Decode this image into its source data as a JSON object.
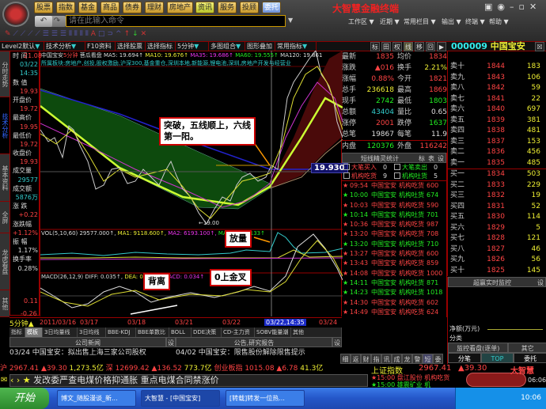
{
  "app": {
    "title": "大智慧金融终端",
    "menu": [
      "股票",
      "指数",
      "基金",
      "商品",
      "债券",
      "理财",
      "房地产",
      "资讯",
      "服务",
      "投顾",
      "委托"
    ],
    "command_placeholder": "请在此输入命令",
    "right_menu": [
      "工作区 ▼",
      "近期 ▼",
      "常用栏目 ▼",
      "输出 ▼",
      "终端 ▼",
      "帮助 ▼"
    ]
  },
  "toolbar": {
    "items": [
      "Level2默认",
      "技术分析",
      "F10资料",
      "选择股票",
      "选择指标",
      "5分钟",
      "多图组合",
      "图形叠加",
      "常用指标"
    ],
    "view_buttons": [
      "标",
      "田",
      "权",
      "线",
      "移",
      "回",
      "▶"
    ],
    "stock_code": "000009",
    "stock_name": "中国宝安",
    "close": "☒"
  },
  "side_tabs": [
    "分时走势",
    "技术分析",
    "基本资料",
    "全屏",
    "龙虎看盘",
    "其他"
  ],
  "info_panel": [
    [
      "时  间",
      "03/22",
      "14:35"
    ],
    [
      "数  值",
      "19.93"
    ],
    [
      "开盘价",
      "19.72"
    ],
    [
      "最高价",
      "19.95"
    ],
    [
      "最低价",
      "19.72"
    ],
    [
      "收盘价",
      "19.93"
    ],
    [
      "成交量",
      "29577"
    ],
    [
      "成交额",
      "5876万"
    ],
    [
      "涨  跌",
      "+0.22"
    ],
    [
      "涨跌幅",
      "+1.12%"
    ],
    [
      "振  幅",
      "1.17%"
    ],
    [
      "换手率",
      "0.28%"
    ]
  ],
  "chart": {
    "header": "中国宝安",
    "period": "5分钟",
    "mode": "菩瓜看盘",
    "ma5": "MA5: 19.694↑",
    "ma10": "MA10: 19.676↑",
    "ma35": "MA35: 19.686↑",
    "ma60": "MA60: 19.555↑",
    "ma120": "MA120: 19.861",
    "sectors": "所属板块:房地产,创投,股权激励,沪深300,基金重仓,深圳本地,新能源,锂电池,深圳,房地产开发与经营业",
    "price_top": "21.08",
    "low_mark": "←19.00",
    "price_tag": "19.930",
    "vol_header": "VOL(5,10,60) 29577.000↑,",
    "vol_ma1": "MA1: 9118.600↑,",
    "vol_ma2": "MA2: 6193.100↑,",
    "vol_ma3": "MA3: 6293.133↑",
    "macd_header": "MACD(26,12,9)",
    "diff": "DIFF: 0.035↑,",
    "dea": "DEA: 0.018↑,",
    "macd": "MACD: 0.034↑",
    "macd_top": "0.11",
    "macd_bottom": "-0.26",
    "period_label": "5分钟▲",
    "dates": [
      "2011/03/16",
      "03/17",
      "03/18",
      "03/21",
      "03/22",
      "03/22,14:35",
      "03/24"
    ],
    "notes": {
      "breakout": "突破，五线顺上，六线第一阳。",
      "volume": "放量",
      "divergence": "背离",
      "golden_cross": "0上金叉"
    }
  },
  "quote": [
    [
      "最新",
      "1835",
      "均价",
      "1834"
    ],
    [
      "涨跌",
      "▲016",
      "换手",
      "2.21%"
    ],
    [
      "涨幅",
      "0.88%",
      "今开",
      "1821"
    ],
    [
      "总手",
      "236618",
      "最高",
      "1869"
    ],
    [
      "现手",
      "2742",
      "最低",
      "1803"
    ],
    [
      "总额",
      "43404",
      "量比",
      "0.65"
    ],
    [
      "涨停",
      "2001",
      "跌停",
      "1637"
    ],
    [
      "总笔",
      "19867",
      "每笔",
      "11.9"
    ],
    [
      "内盘",
      "120376",
      "外盘",
      "116242"
    ]
  ],
  "elf": {
    "title": "短线精灵统计",
    "btns": [
      "标",
      "表",
      "设"
    ],
    "counts": [
      [
        "大笔买入",
        "0",
        "大笔卖出",
        "0"
      ],
      [
        "机构吃货",
        "9",
        "机构吐货",
        "5"
      ]
    ],
    "rows": [
      [
        "09:54",
        "中国宝安",
        "机构吃货",
        "600",
        "b"
      ],
      [
        "10:00",
        "中国宝安",
        "机构吐货",
        "674",
        "s"
      ],
      [
        "10:03",
        "中国宝安",
        "机构吃货",
        "590",
        "b"
      ],
      [
        "10:14",
        "中国宝安",
        "机构吐货",
        "701",
        "s"
      ],
      [
        "10:36",
        "中国宝安",
        "机构吃货",
        "987",
        "b"
      ],
      [
        "13:20",
        "中国宝安",
        "机构吃货",
        "708",
        "b"
      ],
      [
        "13:20",
        "中国宝安",
        "机构吐货",
        "710",
        "s"
      ],
      [
        "13:27",
        "中国宝安",
        "机构吃货",
        "600",
        "b"
      ],
      [
        "13:43",
        "中国宝安",
        "机构吃货",
        "859",
        "b"
      ],
      [
        "14:08",
        "中国宝安",
        "机构吃货",
        "1000",
        "b"
      ],
      [
        "14:11",
        "中国宝安",
        "机构吐货",
        "871",
        "s"
      ],
      [
        "14:23",
        "中国宝安",
        "机构吐货",
        "1018",
        "s"
      ],
      [
        "14:30",
        "中国宝安",
        "机构吃货",
        "602",
        "b"
      ],
      [
        "14:49",
        "中国宝安",
        "机构吃货",
        "624",
        "b"
      ]
    ]
  },
  "book": {
    "sell": [
      [
        "卖十",
        "1844",
        "183"
      ],
      [
        "卖九",
        "1843",
        "106"
      ],
      [
        "卖八",
        "1842",
        "59"
      ],
      [
        "卖七",
        "1841",
        "22"
      ],
      [
        "卖六",
        "1840",
        "697"
      ],
      [
        "卖五",
        "1839",
        "381"
      ],
      [
        "卖四",
        "1838",
        "481"
      ],
      [
        "卖三",
        "1837",
        "153"
      ],
      [
        "卖二",
        "1836",
        "456"
      ],
      [
        "卖一",
        "1835",
        "485"
      ]
    ],
    "buy": [
      [
        "买一",
        "1834",
        "503"
      ],
      [
        "买二",
        "1833",
        "229"
      ],
      [
        "买三",
        "1832",
        "19"
      ],
      [
        "买四",
        "1831",
        "52"
      ],
      [
        "买五",
        "1830",
        "114"
      ],
      [
        "买六",
        "1829",
        "5"
      ],
      [
        "买七",
        "1828",
        "121"
      ],
      [
        "买八",
        "1827",
        "46"
      ],
      [
        "买九",
        "1826",
        "56"
      ],
      [
        "买十",
        "1825",
        "145"
      ]
    ],
    "monitor": "超赢实时监控",
    "monitor_btn": "设",
    "net": "净额(万元)",
    "category": "分类",
    "sub_tabs": [
      "监控看盘(逐单)",
      "其它"
    ],
    "bottom_tabs": [
      "分笔",
      "TOP",
      "委托"
    ],
    "mini_tabs": [
      "细",
      "返",
      "财",
      "指",
      "讯",
      "成",
      "龙",
      "警",
      "短",
      "委"
    ]
  },
  "indicator_tabs": [
    "指标",
    "模板",
    "3日均量线",
    "3日均线",
    "BBE-KDJ",
    "BBE单数比",
    "BOLL",
    "DDE决策",
    "CD-主力资",
    "SOBV能量潮",
    "其他"
  ],
  "news": {
    "left_title": "公司新闻",
    "right_title": "公告,研究报告",
    "btn": "设",
    "left_item": "03/24 中国宝安：拟出售上海三家公司股权",
    "right_item": "04/02 中国宝安：限售股份解除限售提示"
  },
  "indices": {
    "sh": [
      "沪",
      "2967.41",
      "▲39.30",
      "1,273.5亿"
    ],
    "sz": [
      "深",
      "12699.42",
      "▲136.52",
      "773.7亿"
    ],
    "cy": [
      "创业板指",
      "1015.08",
      "▲6.78",
      "41.3亿"
    ]
  },
  "scroll_news": "发改委严查电煤价格抑通胀 重点电煤合同禁涨价",
  "br_panel": {
    "index_name": "上证指数",
    "index_value": "2967.41",
    "index_change": "▲39.30",
    "alert1": "★15:00 盘江股份 机构吃货",
    "alert2": "★15:00 雄震矿业 机",
    "brand": "大智慧",
    "time": "06:06"
  },
  "taskbar": {
    "start": "开始",
    "tasks": [
      "博文_随股漫谈_新...",
      "大智慧 - [中国宝安]",
      "[转载]转发一位热..."
    ],
    "clock": "10:06"
  }
}
